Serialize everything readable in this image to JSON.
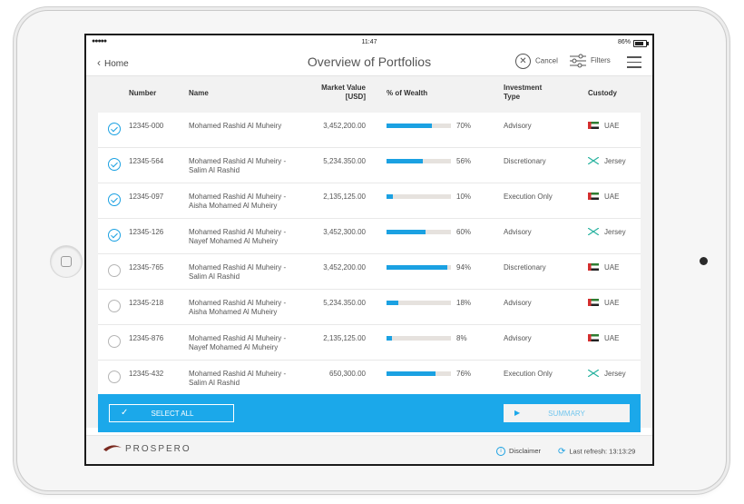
{
  "status": {
    "signal": "●●●●● ",
    "wifi": "wifi-icon",
    "time": "11:47",
    "battery": "86%"
  },
  "nav": {
    "back_label": "Home",
    "title": "Overview of Portfolios",
    "cancel_label": "Cancel",
    "filters_label": "Filters"
  },
  "table": {
    "headers": {
      "number": "Number",
      "name": "Name",
      "market_value_1": "Market Value",
      "market_value_2": "[USD]",
      "wealth": "% of Wealth",
      "type_1": "Investment",
      "type_2": "Type",
      "custody": "Custody"
    },
    "rows": [
      {
        "checked": true,
        "number": "12345-000",
        "name_1": "Mohamed Rashid Al Muheiry",
        "name_2": "",
        "market_value": "3,452,200.00",
        "wealth_pct": 70,
        "wealth_label": "70%",
        "type": "Advisory",
        "custody_flag": "uae",
        "custody": "UAE"
      },
      {
        "checked": true,
        "number": "12345-564",
        "name_1": "Mohamed Rashid Al Muheiry -",
        "name_2": "Salim Al Rashid",
        "market_value": "5,234.350.00",
        "wealth_pct": 56,
        "wealth_label": "56%",
        "type": "Discretionary",
        "custody_flag": "jersey",
        "custody": "Jersey"
      },
      {
        "checked": true,
        "number": "12345-097",
        "name_1": "Mohamed Rashid Al Muheiry -",
        "name_2": "Aisha Mohamed Al Muheiry",
        "market_value": "2,135,125.00",
        "wealth_pct": 10,
        "wealth_label": "10%",
        "type": "Execution Only",
        "custody_flag": "uae",
        "custody": "UAE"
      },
      {
        "checked": true,
        "number": "12345-126",
        "name_1": "Mohamed Rashid Al Muheiry -",
        "name_2": "Nayef Mohamed Al Muheiry",
        "market_value": "3,452,300.00",
        "wealth_pct": 60,
        "wealth_label": "60%",
        "type": "Advisory",
        "custody_flag": "jersey",
        "custody": "Jersey"
      },
      {
        "checked": false,
        "number": "12345-765",
        "name_1": "Mohamed Rashid Al Muheiry -",
        "name_2": "Salim Al Rashid",
        "market_value": "3,452,200.00",
        "wealth_pct": 94,
        "wealth_label": "94%",
        "type": "Discretionary",
        "custody_flag": "uae",
        "custody": "UAE"
      },
      {
        "checked": false,
        "number": "12345-218",
        "name_1": "Mohamed Rashid Al Muheiry -",
        "name_2": "Aisha Mohamed Al Muheiry",
        "market_value": "5,234.350.00",
        "wealth_pct": 18,
        "wealth_label": "18%",
        "type": "Advisory",
        "custody_flag": "uae",
        "custody": "UAE"
      },
      {
        "checked": false,
        "number": "12345-876",
        "name_1": "Mohamed Rashid Al Muheiry -",
        "name_2": "Nayef Mohamed Al Muheiry",
        "market_value": "2,135,125.00",
        "wealth_pct": 8,
        "wealth_label": "8%",
        "type": "Advisory",
        "custody_flag": "uae",
        "custody": "UAE"
      },
      {
        "checked": false,
        "number": "12345-432",
        "name_1": "Mohamed Rashid Al Muheiry -",
        "name_2": "Salim Al Rashid",
        "market_value": "650,300.00",
        "wealth_pct": 76,
        "wealth_label": "76%",
        "type": "Execution Only",
        "custody_flag": "jersey",
        "custody": "Jersey"
      }
    ]
  },
  "actions": {
    "select_all_label": "SELECT ALL",
    "summary_label": "SUMMARY"
  },
  "footer": {
    "logo_text": "PROSPERO",
    "disclaimer_label": "Disclaimer",
    "last_refresh_label": "Last refresh: 13:13:29"
  },
  "colors": {
    "accent": "#1ba8ea",
    "bar_track": "#e6e2de"
  }
}
